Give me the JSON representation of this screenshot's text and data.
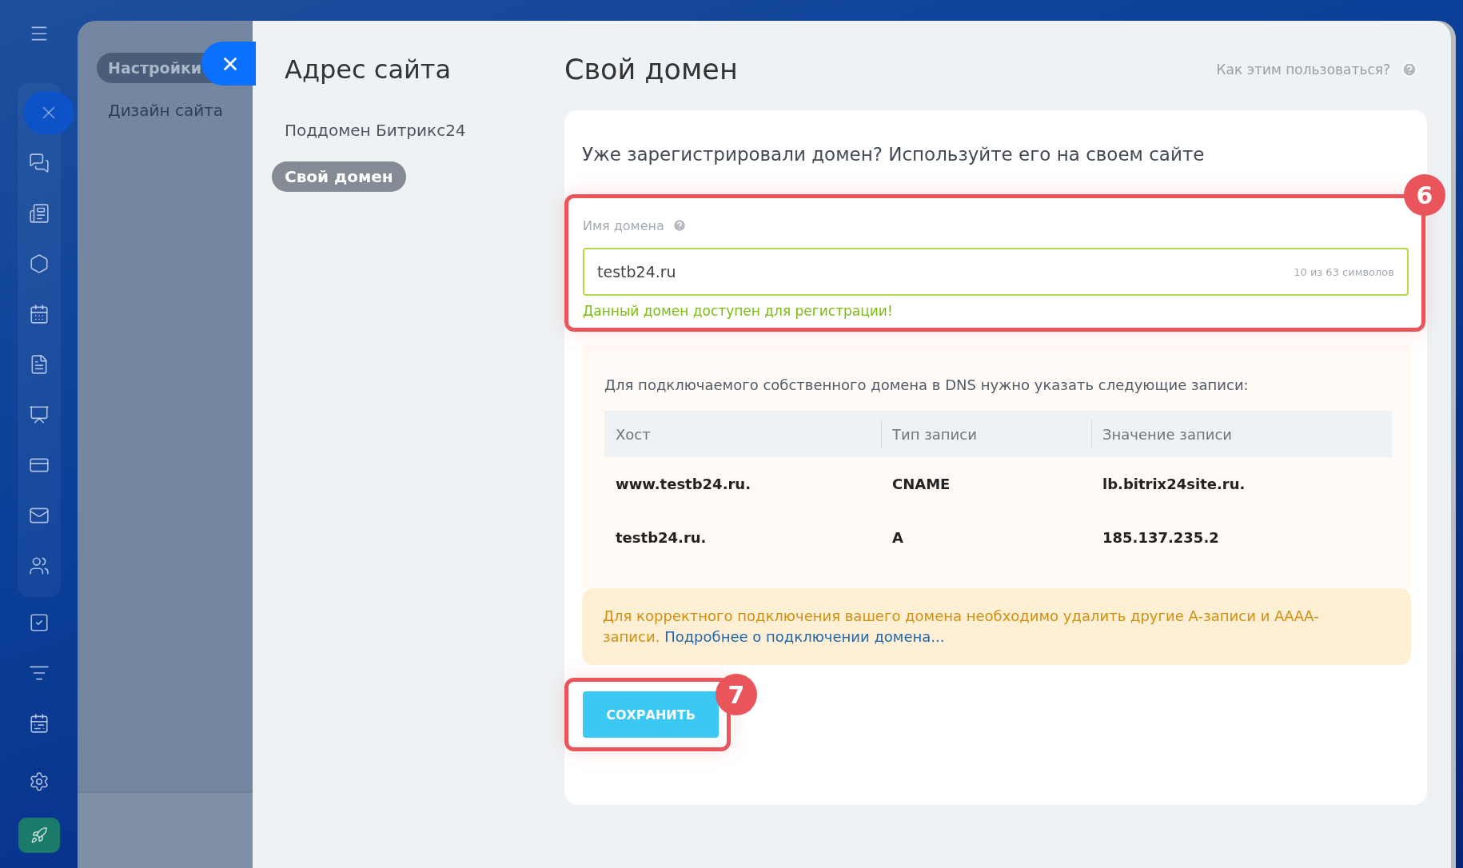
{
  "back_panel": {
    "title": "Настройки",
    "items": [
      "Дизайн сайта"
    ]
  },
  "nav": {
    "title": "Адрес сайта",
    "items": [
      {
        "label": "Поддомен Битрикс24",
        "selected": false
      },
      {
        "label": "Свой домен",
        "selected": true
      }
    ]
  },
  "header": {
    "title": "Свой домен",
    "help_link": "Как этим пользоваться?"
  },
  "card": {
    "heading": "Уже зарегистрировали домен? Используйте его на своем сайте",
    "domain_field": {
      "label": "Имя домена",
      "value": "testb24.ru",
      "counter": "10 из 63 символов",
      "status": "Данный домен доступен для регистрации!",
      "valid": true,
      "badge": "6"
    },
    "dns": {
      "intro": "Для подключаемого собственного домена в DNS нужно указать следующие записи:",
      "columns": [
        "Хост",
        "Тип записи",
        "Значение записи"
      ],
      "rows": [
        [
          "www.testb24.ru.",
          "CNAME",
          "lb.bitrix24site.ru."
        ],
        [
          "testb24.ru.",
          "A",
          "185.137.235.2"
        ]
      ]
    },
    "warning": {
      "text": "Для корректного подключения вашего домена необходимо удалить другие А-записи и АААА-записи.",
      "link": "Подробнее о подключении домена..."
    },
    "save_button": {
      "label": "СОХРАНИТЬ",
      "badge": "7"
    }
  }
}
